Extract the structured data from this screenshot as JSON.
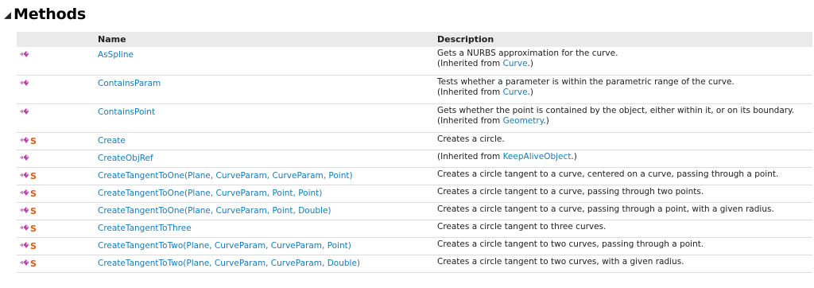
{
  "section": {
    "title": "Methods"
  },
  "columns": {
    "name": "Name",
    "description": "Description"
  },
  "inherited_prefix": "(Inherited from ",
  "inherited_suffix": ".)",
  "static_marker": "S",
  "rows": [
    {
      "name": "AsSpline",
      "static": false,
      "description": "Gets a NURBS approximation for the curve.",
      "inherited_from": "Curve"
    },
    {
      "name": "ContainsParam",
      "static": false,
      "description": "Tests whether a parameter is within the parametric range of the curve.",
      "inherited_from": "Curve"
    },
    {
      "name": "ContainsPoint",
      "static": false,
      "description": "Gets whether the point is contained by the object, either within it, or on its boundary.",
      "inherited_from": "Geometry"
    },
    {
      "name": "Create",
      "static": true,
      "description": "Creates a circle.",
      "inherited_from": null
    },
    {
      "name": "CreateObjRef",
      "static": false,
      "description": "",
      "inherited_from": "KeepAliveObject"
    },
    {
      "name": "CreateTangentToOne(Plane, CurveParam, CurveParam, Point)",
      "static": true,
      "description": "Creates a circle tangent to a curve, centered on a curve, passing through a point.",
      "inherited_from": null
    },
    {
      "name": "CreateTangentToOne(Plane, CurveParam, Point, Point)",
      "static": true,
      "description": "Creates a circle tangent to a curve, passing through two points.",
      "inherited_from": null
    },
    {
      "name": "CreateTangentToOne(Plane, CurveParam, Point, Double)",
      "static": true,
      "description": "Creates a circle tangent to a curve, passing through a point, with a given radius.",
      "inherited_from": null
    },
    {
      "name": "CreateTangentToThree",
      "static": true,
      "description": "Creates a circle tangent to three curves.",
      "inherited_from": null
    },
    {
      "name": "CreateTangentToTwo(Plane, CurveParam, CurveParam, Point)",
      "static": true,
      "description": "Creates a circle tangent to two curves, passing through a point.",
      "inherited_from": null
    },
    {
      "name": "CreateTangentToTwo(Plane, CurveParam, CurveParam, Double)",
      "static": true,
      "description": "Creates a circle tangent to two curves, with a given radius.",
      "inherited_from": null
    }
  ]
}
